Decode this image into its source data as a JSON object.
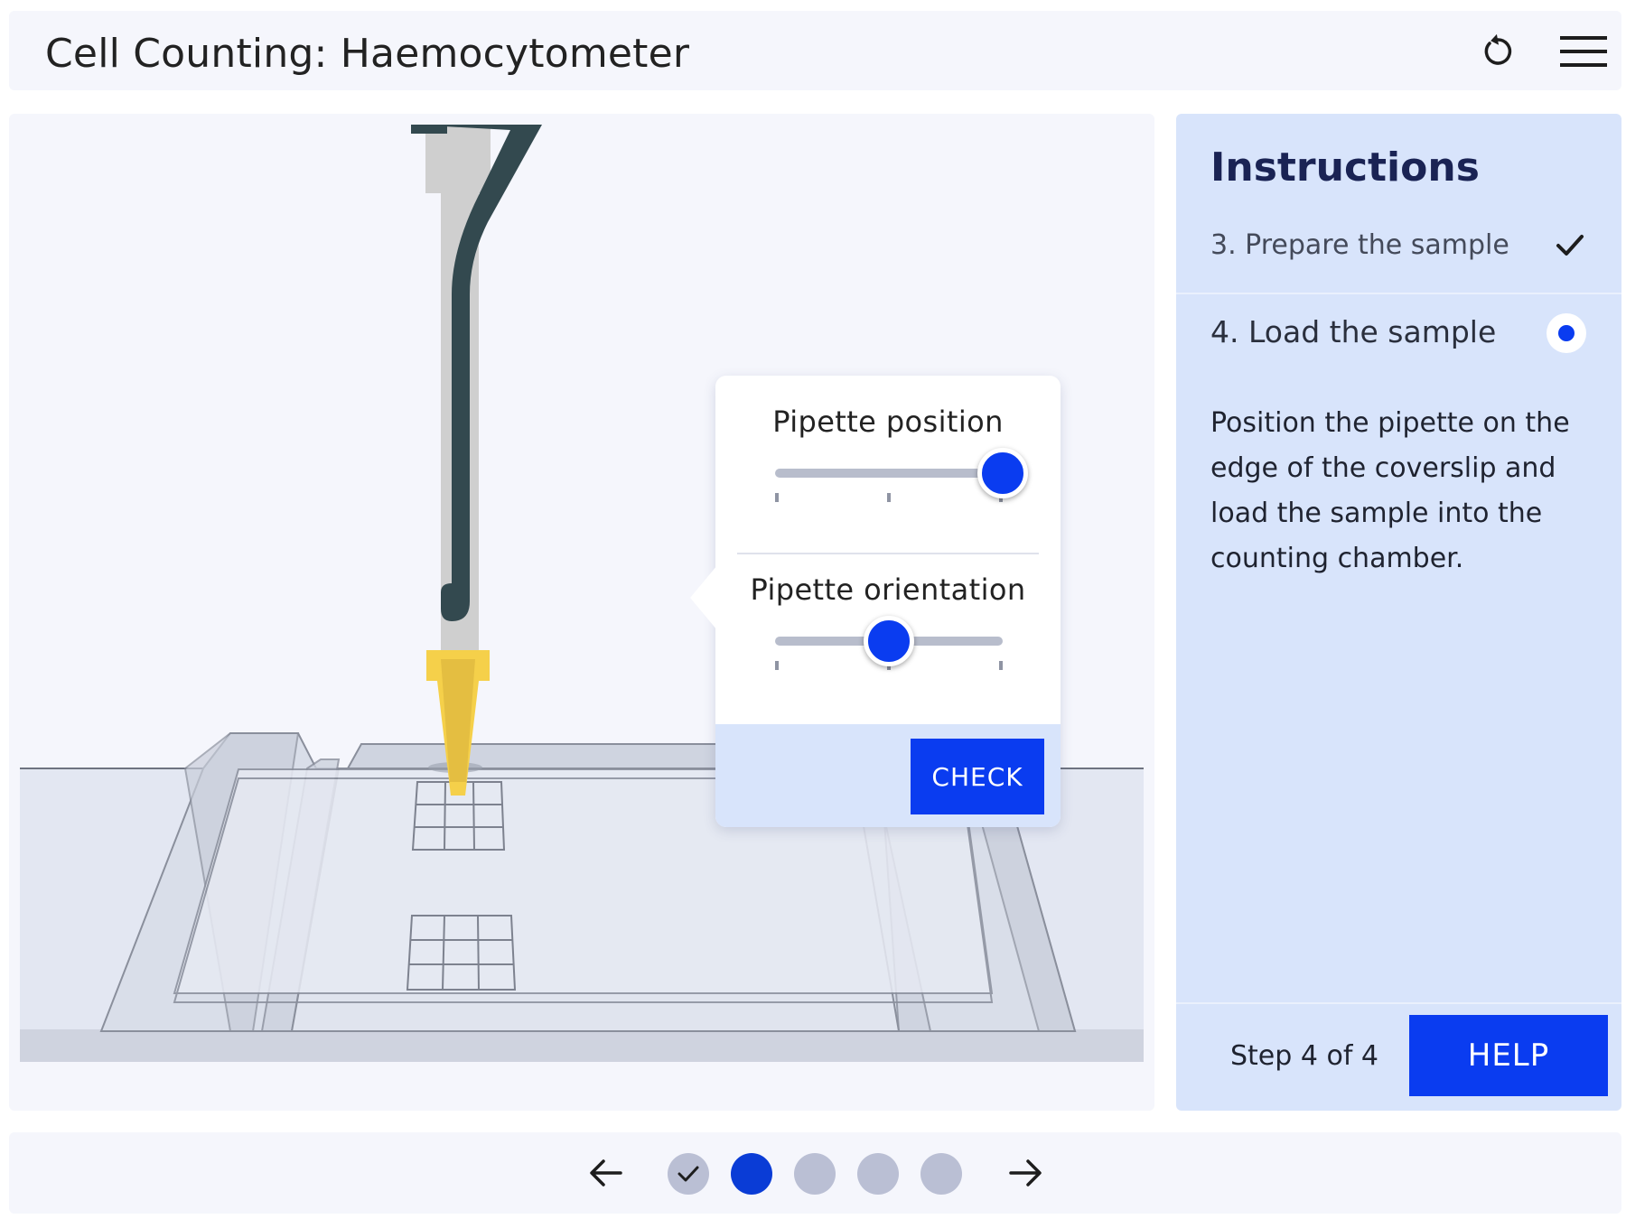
{
  "header": {
    "title": "Cell Counting: Haemocytometer",
    "reset_icon": "reset-icon",
    "menu_icon": "hamburger-menu-icon"
  },
  "controls": {
    "pipette_position": {
      "label": "Pipette position",
      "value_fraction": 1.0,
      "tick_count": 3
    },
    "pipette_orientation": {
      "label": "Pipette orientation",
      "value_fraction": 0.5,
      "tick_count": 3
    },
    "check_label": "CHECK"
  },
  "instructions": {
    "title": "Instructions",
    "steps": [
      {
        "label": "3. Prepare the sample",
        "status": "complete"
      },
      {
        "label": "4. Load the sample",
        "status": "current",
        "description": "Position the pipette on the edge of the coverslip and load the sample into the counting chamber."
      }
    ],
    "step_counter": "Step 4 of 4",
    "help_label": "HELP"
  },
  "nav": {
    "dots": [
      {
        "state": "complete"
      },
      {
        "state": "current"
      },
      {
        "state": "upcoming"
      },
      {
        "state": "upcoming"
      },
      {
        "state": "upcoming"
      }
    ],
    "prev_icon": "arrow-left-icon",
    "next_icon": "arrow-right-icon"
  },
  "colors": {
    "accent": "#0a3cf0",
    "panel_bg": "#d8e4fb",
    "surface_bg": "#f5f6fc",
    "pipette_tip": "#f5d04a",
    "pipette_body": "#33494f"
  }
}
